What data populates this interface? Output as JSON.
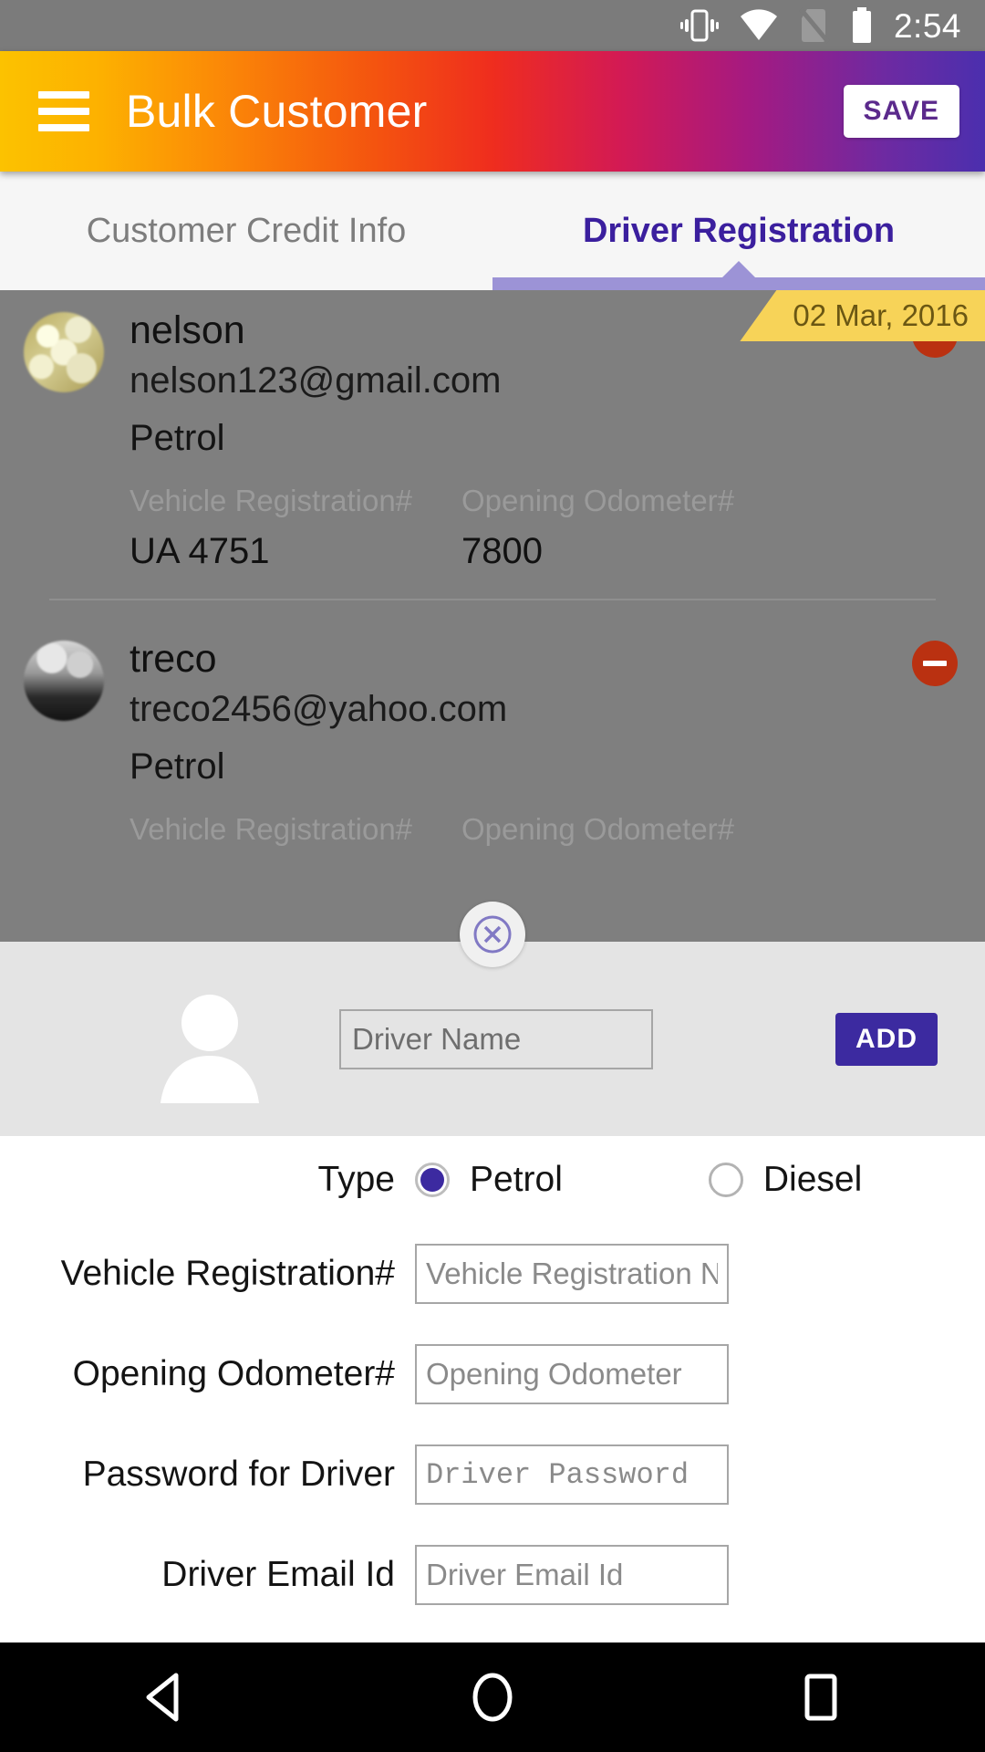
{
  "status_bar": {
    "time": "2:54",
    "icons": [
      "vibrate-icon",
      "wifi-icon",
      "no-sim-icon",
      "battery-icon"
    ]
  },
  "app_bar": {
    "menu_icon": "hamburger-menu-icon",
    "title": "Bulk Customer",
    "save_label": "SAVE"
  },
  "tabs": [
    {
      "label": "Customer Credit Info",
      "active": false
    },
    {
      "label": "Driver Registration",
      "active": true
    }
  ],
  "driver_list": {
    "date_badge": "02 Mar, 2016",
    "field_labels": {
      "vehicle_registration": "Vehicle Registration#",
      "opening_odometer": "Opening Odometer#"
    },
    "drivers": [
      {
        "name": "nelson",
        "email": "nelson123@gmail.com",
        "fuel_type": "Petrol",
        "vehicle_registration": "UA 4751",
        "opening_odometer": "7800",
        "remove_icon": "remove-circle-icon"
      },
      {
        "name": "treco",
        "email": "treco2456@yahoo.com",
        "fuel_type": "Petrol",
        "vehicle_registration": "",
        "opening_odometer": "",
        "remove_icon": "remove-circle-icon"
      }
    ]
  },
  "add_sheet": {
    "close_icon": "close-circle-icon",
    "avatar_icon": "person-placeholder-icon",
    "driver_name_placeholder": "Driver Name",
    "driver_name_value": "",
    "add_label": "ADD"
  },
  "form": {
    "type_label": "Type",
    "type_options": [
      {
        "label": "Petrol",
        "selected": true
      },
      {
        "label": "Diesel",
        "selected": false
      }
    ],
    "fields": [
      {
        "label": "Vehicle Registration#",
        "placeholder": "Vehicle Registration Number",
        "value": "",
        "mono": false
      },
      {
        "label": "Opening Odometer#",
        "placeholder": "Opening Odometer",
        "value": "",
        "mono": false
      },
      {
        "label": "Password for Driver",
        "placeholder": "Driver Password",
        "value": "",
        "mono": true
      },
      {
        "label": "Driver Email Id",
        "placeholder": "Driver Email Id",
        "value": "",
        "mono": false
      }
    ]
  },
  "nav_bar": {
    "back_icon": "back-triangle-icon",
    "home_icon": "home-circle-icon",
    "recents_icon": "recents-square-icon"
  },
  "colors": {
    "accent_purple": "#3c2aa0",
    "tab_active": "#3b1f9e",
    "tab_indicator": "#9c93d6",
    "date_badge_bg": "#f7d358",
    "remove_red": "#ba3111",
    "dim_overlay": "#7f7f7f"
  }
}
